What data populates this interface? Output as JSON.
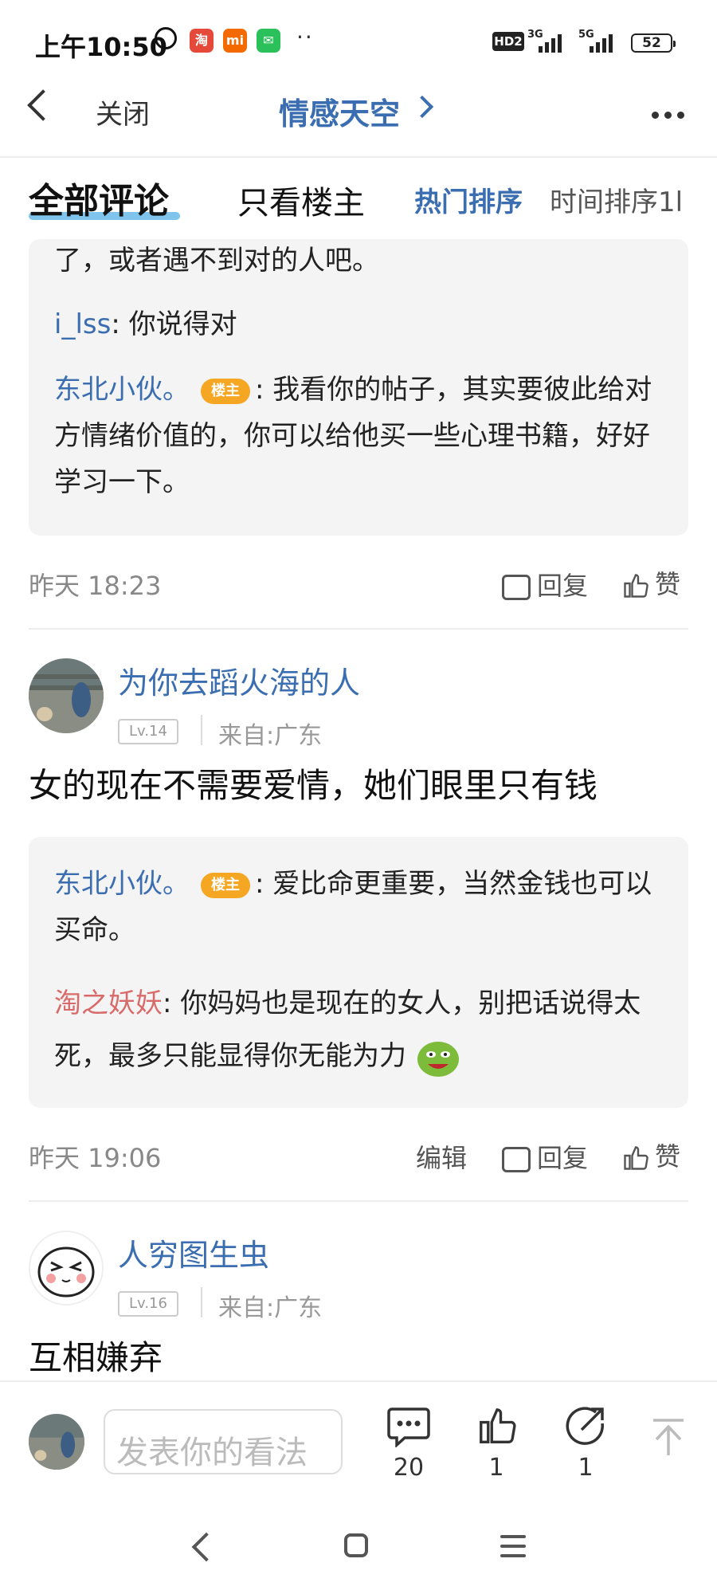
{
  "status_bar": {
    "time": "上午10:50",
    "apps": [
      {
        "name": "taobao",
        "glyph": "淘",
        "color": "#e5493a"
      },
      {
        "name": "xiaomi",
        "glyph": "mi",
        "color": "#f56a00"
      },
      {
        "name": "wechat",
        "glyph": "✉",
        "color": "#2bc15a"
      }
    ],
    "more": "··",
    "hd": "HD2",
    "net1": "3G",
    "net2": "5G",
    "battery": "52"
  },
  "nav": {
    "close_label": "关闭",
    "title": "情感天空"
  },
  "tabs": {
    "all": "全部评论",
    "op_only": "只看楼主",
    "sort_hot": "热门排序",
    "sort_time": "时间排序1l"
  },
  "thread1": {
    "partial_text": "了，或者遇不到对的人吧。",
    "replies": [
      {
        "user": "i_lss",
        "text": ": 你说得对"
      },
      {
        "user": "东北小伙。",
        "badge": "楼主",
        "text": ": 我看你的帖子，其实要彼此给对方情绪价值的，你可以给他买一些心理书籍，好好学习一下。"
      }
    ],
    "time": "昨天 18:23",
    "reply_label": "回复",
    "like_label": "赞"
  },
  "comment2": {
    "user": "为你去蹈火海的人",
    "level": "Lv.14",
    "from": "来自:广东",
    "text": "女的现在不需要爱情，她们眼里只有钱",
    "replies": [
      {
        "user": "东北小伙。",
        "badge": "楼主",
        "text": ": 爱比命更重要，当然金钱也可以买命。"
      },
      {
        "user": "淘之妖妖",
        "text": ": 你妈妈也是现在的女人，别把话说得太死，最多只能显得你无能为力"
      }
    ],
    "time": "昨天 19:06",
    "edit_label": "编辑",
    "reply_label": "回复",
    "like_label": "赞"
  },
  "comment3": {
    "user": "人穷图生虫",
    "level": "Lv.16",
    "from": "来自:广东",
    "text": "互相嫌弃"
  },
  "bottom_bar": {
    "placeholder": "发表你的看法",
    "comment_count": "20",
    "like_count": "1",
    "share_count": "1"
  }
}
